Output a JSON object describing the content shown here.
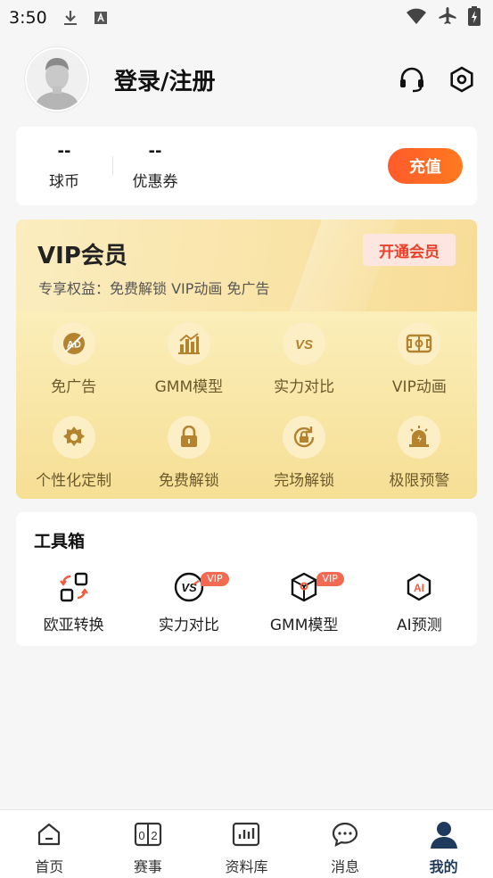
{
  "status_bar": {
    "time": "3:50",
    "left_icons": [
      "download-icon",
      "a-badge-icon"
    ],
    "right_icons": [
      "wifi-icon",
      "airplane-icon",
      "battery-charging-icon"
    ]
  },
  "header": {
    "title": "登录/注册",
    "icons": [
      "headset-icon",
      "settings-icon"
    ]
  },
  "wallet": {
    "coins_value": "--",
    "coins_label": "球币",
    "coupons_value": "--",
    "coupons_label": "优惠券",
    "recharge_label": "充值"
  },
  "vip": {
    "title": "VIP会员",
    "subtitle": "专享权益：免费解锁 VIP动画 免广告",
    "open_button": "开通会员",
    "benefits": [
      {
        "label": "免广告",
        "icon": "ad-free-icon"
      },
      {
        "label": "GMM模型",
        "icon": "bar-chart-icon"
      },
      {
        "label": "实力对比",
        "icon": "versus-icon"
      },
      {
        "label": "VIP动画",
        "icon": "pitch-icon"
      },
      {
        "label": "个性化定制",
        "icon": "gear-flower-icon"
      },
      {
        "label": "免费解锁",
        "icon": "lock-icon"
      },
      {
        "label": "完场解锁",
        "icon": "rotate-lock-icon"
      },
      {
        "label": "极限预警",
        "icon": "alarm-icon"
      }
    ]
  },
  "toolbox": {
    "title": "工具箱",
    "items": [
      {
        "label": "欧亚转换",
        "icon": "convert-icon",
        "badge": ""
      },
      {
        "label": "实力对比",
        "icon": "versus-icon",
        "badge": "VIP"
      },
      {
        "label": "GMM模型",
        "icon": "cube-icon",
        "badge": "VIP"
      },
      {
        "label": "AI预测",
        "icon": "ai-icon",
        "badge": ""
      }
    ]
  },
  "bottom_nav": {
    "items": [
      {
        "label": "首页",
        "icon": "home-icon"
      },
      {
        "label": "赛事",
        "icon": "score-icon"
      },
      {
        "label": "资料库",
        "icon": "stats-icon"
      },
      {
        "label": "消息",
        "icon": "chat-icon"
      },
      {
        "label": "我的",
        "icon": "user-icon"
      }
    ],
    "active_index": 4
  },
  "colors": {
    "accent": "#ff5a2a",
    "vip_text": "#6d5a2c",
    "vip_icon": "#b3832f",
    "nav_active": "#1f3a5c"
  }
}
